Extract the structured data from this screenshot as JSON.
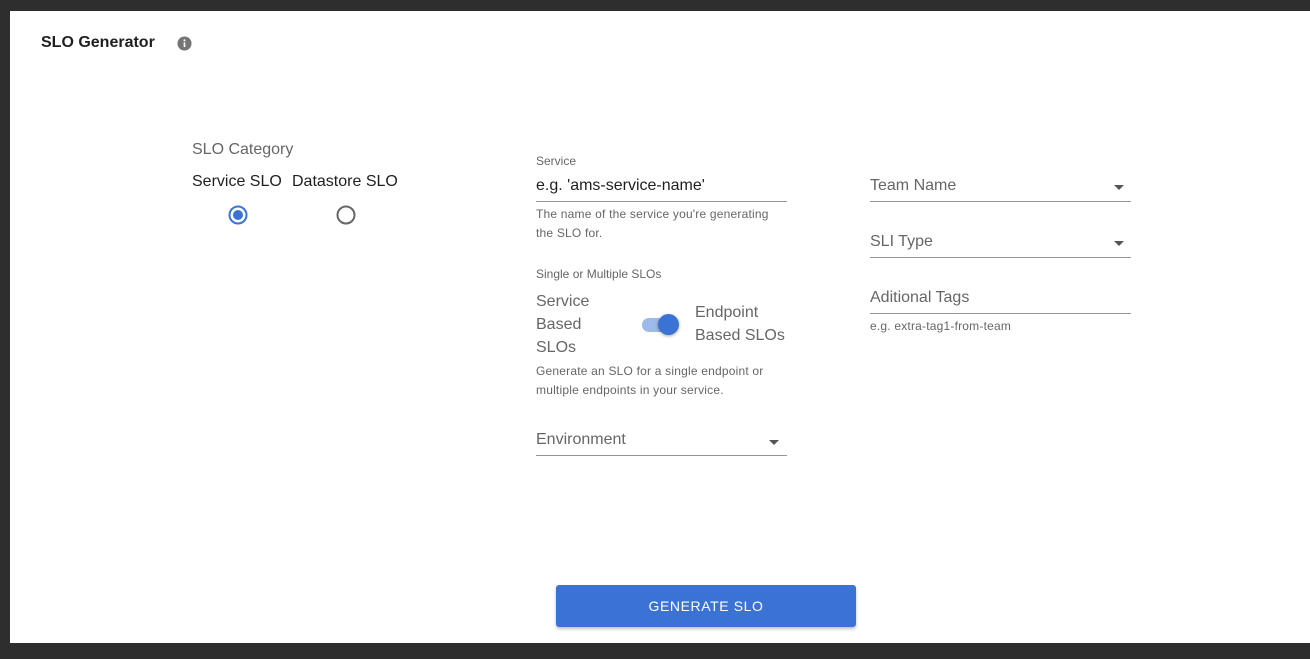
{
  "header": {
    "title": "SLO Generator",
    "info_icon": "info-icon"
  },
  "category": {
    "label": "SLO Category",
    "options": [
      {
        "label": "Service SLO",
        "selected": true
      },
      {
        "label": "Datastore SLO",
        "selected": false
      }
    ]
  },
  "service": {
    "caption": "Service",
    "value": "e.g. 'ams-service-name'",
    "helper_line1": "The name of the service you're generating",
    "helper_line2": "the SLO for."
  },
  "slo_mode": {
    "caption": "Single or Multiple SLOs",
    "left_line1": "Service",
    "left_line2": "Based",
    "left_line3": "SLOs",
    "right_line1": "Endpoint",
    "right_line2": "Based SLOs",
    "toggle_on": true,
    "helper_line1": "Generate an SLO for a single endpoint or",
    "helper_line2": "multiple endpoints in your service."
  },
  "environment": {
    "label": "Environment"
  },
  "team_name": {
    "label": "Team Name"
  },
  "sli_type": {
    "label": "SLI Type"
  },
  "tags": {
    "label": "Aditional Tags",
    "helper": "e.g. extra-tag1-from-team"
  },
  "actions": {
    "generate_label": "GENERATE SLO"
  },
  "colors": {
    "accent": "#3a73d4",
    "accent_light": "#9cbbe8",
    "background": "#2e2e2e"
  }
}
